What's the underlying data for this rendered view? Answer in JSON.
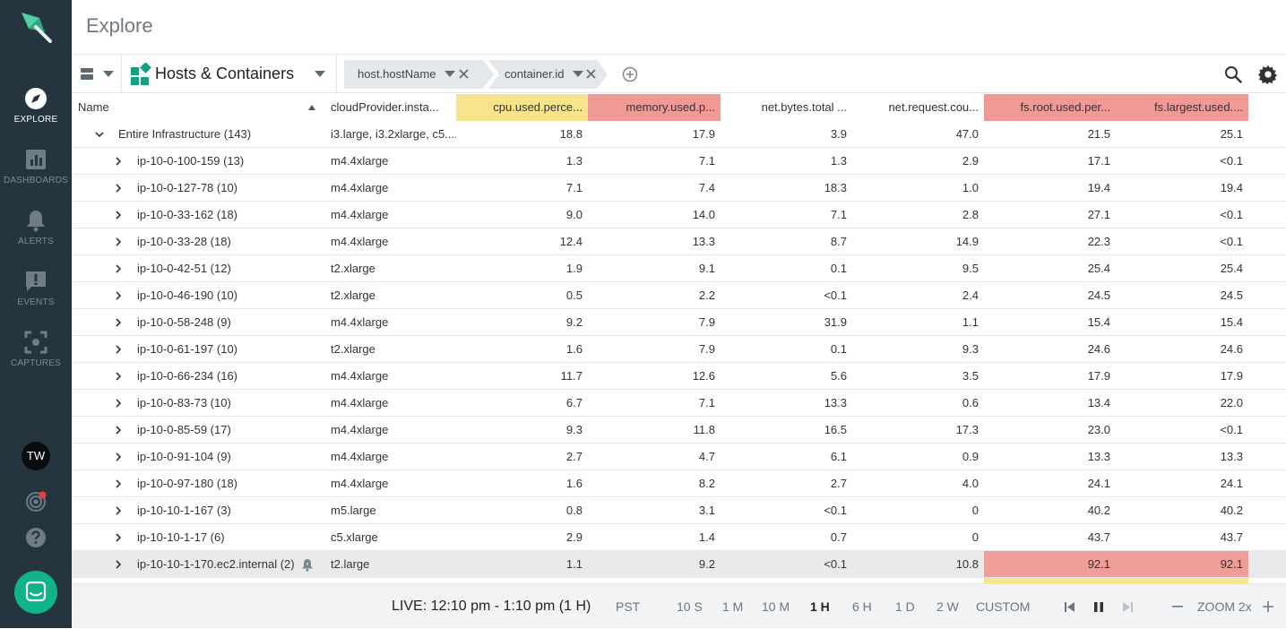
{
  "app": {
    "page_title": "Explore"
  },
  "sidebar": {
    "items": [
      {
        "label": "EXPLORE",
        "icon": "compass-icon",
        "active": true
      },
      {
        "label": "DASHBOARDS",
        "icon": "bar-chart-icon",
        "active": false
      },
      {
        "label": "ALERTS",
        "icon": "bell-icon",
        "active": false
      },
      {
        "label": "EVENTS",
        "icon": "speech-bubble-exclamation-icon",
        "active": false
      },
      {
        "label": "CAPTURES",
        "icon": "capture-frame-icon",
        "active": false
      }
    ],
    "avatar_initials": "TW"
  },
  "toolbar": {
    "group_label": "Hosts & Containers",
    "chips": [
      "host.hostName",
      "container.id"
    ]
  },
  "table": {
    "columns": [
      "Name",
      "cloudProvider.insta...",
      "cpu.used.perce...",
      "memory.used.p...",
      "net.bytes.total ...",
      "net.request.cou...",
      "fs.root.used.per...",
      "fs.largest.used...."
    ],
    "rows": [
      {
        "name": "Entire Infrastructure (143)",
        "level": 0,
        "expanded": true,
        "cells": [
          "i3.large, i3.2xlarge, c5....",
          "18.8",
          "17.9",
          "3.9",
          "47.0",
          "21.5",
          "25.1"
        ]
      },
      {
        "name": "ip-10-0-100-159 (13)",
        "level": 1,
        "cells": [
          "m4.4xlarge",
          "1.3",
          "7.1",
          "1.3",
          "2.9",
          "17.1",
          "<0.1"
        ]
      },
      {
        "name": "ip-10-0-127-78 (10)",
        "level": 1,
        "cells": [
          "m4.4xlarge",
          "7.1",
          "7.4",
          "18.3",
          "1.0",
          "19.4",
          "19.4"
        ]
      },
      {
        "name": "ip-10-0-33-162 (18)",
        "level": 1,
        "cells": [
          "m4.4xlarge",
          "9.0",
          "14.0",
          "7.1",
          "2.8",
          "27.1",
          "<0.1"
        ]
      },
      {
        "name": "ip-10-0-33-28 (18)",
        "level": 1,
        "cells": [
          "m4.4xlarge",
          "12.4",
          "13.3",
          "8.7",
          "14.9",
          "22.3",
          "<0.1"
        ]
      },
      {
        "name": "ip-10-0-42-51 (12)",
        "level": 1,
        "cells": [
          "t2.xlarge",
          "1.9",
          "9.1",
          "0.1",
          "9.5",
          "25.4",
          "25.4"
        ]
      },
      {
        "name": "ip-10-0-46-190 (10)",
        "level": 1,
        "cells": [
          "t2.xlarge",
          "0.5",
          "2.2",
          "<0.1",
          "2.4",
          "24.5",
          "24.5"
        ]
      },
      {
        "name": "ip-10-0-58-248 (9)",
        "level": 1,
        "cells": [
          "m4.4xlarge",
          "9.2",
          "7.9",
          "31.9",
          "1.1",
          "15.4",
          "15.4"
        ]
      },
      {
        "name": "ip-10-0-61-197 (10)",
        "level": 1,
        "cells": [
          "t2.xlarge",
          "1.6",
          "7.9",
          "0.1",
          "9.3",
          "24.6",
          "24.6"
        ]
      },
      {
        "name": "ip-10-0-66-234 (16)",
        "level": 1,
        "cells": [
          "m4.4xlarge",
          "11.7",
          "12.6",
          "5.6",
          "3.5",
          "17.9",
          "17.9"
        ]
      },
      {
        "name": "ip-10-0-83-73 (10)",
        "level": 1,
        "cells": [
          "m4.4xlarge",
          "6.7",
          "7.1",
          "13.3",
          "0.6",
          "13.4",
          "22.0"
        ]
      },
      {
        "name": "ip-10-0-85-59 (17)",
        "level": 1,
        "cells": [
          "m4.4xlarge",
          "9.3",
          "11.8",
          "16.5",
          "17.3",
          "23.0",
          "<0.1"
        ]
      },
      {
        "name": "ip-10-0-91-104 (9)",
        "level": 1,
        "cells": [
          "m4.4xlarge",
          "2.7",
          "4.7",
          "6.1",
          "0.9",
          "13.3",
          "13.3"
        ]
      },
      {
        "name": "ip-10-0-97-180 (18)",
        "level": 1,
        "cells": [
          "m4.4xlarge",
          "1.6",
          "8.2",
          "2.7",
          "4.0",
          "24.1",
          "24.1"
        ]
      },
      {
        "name": "ip-10-10-1-167 (3)",
        "level": 1,
        "cells": [
          "m5.large",
          "0.8",
          "3.1",
          "<0.1",
          "0",
          "40.2",
          "40.2"
        ]
      },
      {
        "name": "ip-10-10-1-17 (6)",
        "level": 1,
        "cells": [
          "c5.xlarge",
          "2.9",
          "1.4",
          "0.7",
          "0",
          "43.7",
          "43.7"
        ]
      },
      {
        "name": "ip-10-10-1-170.ec2.internal (2)",
        "level": 1,
        "selected": true,
        "alert": true,
        "cells": [
          "t2.large",
          "1.1",
          "9.2",
          "<0.1",
          "10.8",
          "92.1",
          "92.1"
        ]
      }
    ]
  },
  "timebar": {
    "live_label": "LIVE: 12:10 pm - 1:10 pm (1 H)",
    "timezone": "PST",
    "ranges": [
      "10 S",
      "1 M",
      "10 M",
      "1 H",
      "6 H",
      "1 D",
      "2 W",
      "CUSTOM"
    ],
    "selected_range": "1 H",
    "zoom_label": "ZOOM 2x"
  },
  "colors": {
    "sidebar_bg": "#253540",
    "accent_green": "#10b488",
    "header_yellow": "#f7e48b",
    "header_red": "#ef9a96",
    "cell_red": "#ee9d98",
    "chip_bg": "#e4e8eb"
  }
}
